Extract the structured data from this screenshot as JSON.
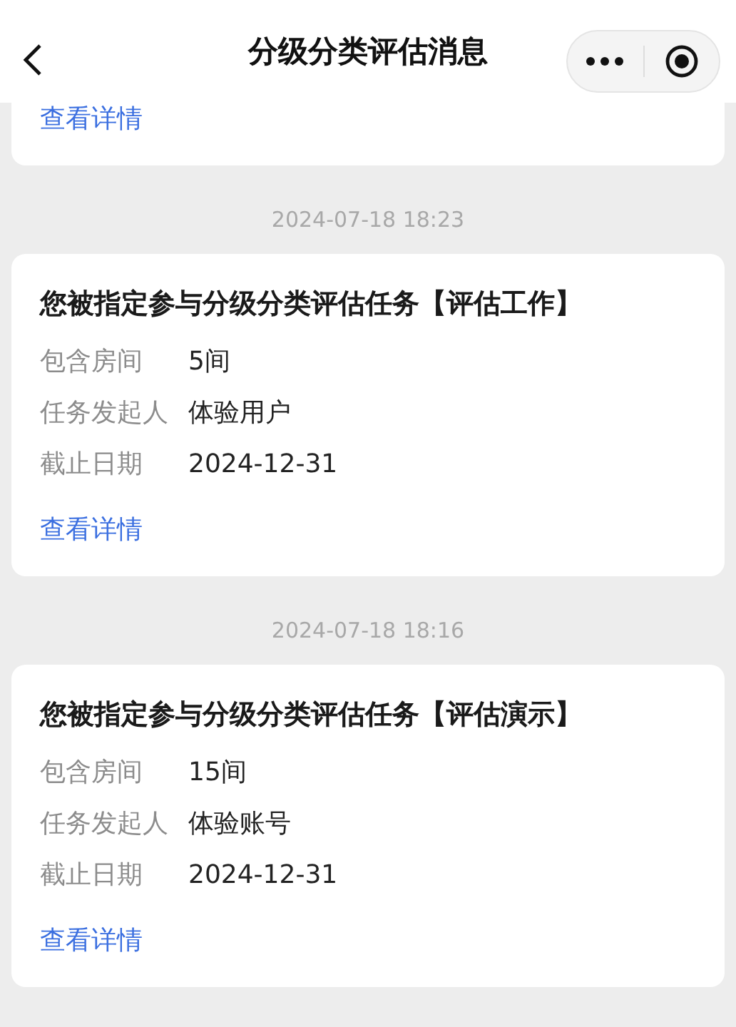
{
  "header": {
    "title": "分级分类评估消息"
  },
  "messages": [
    {
      "kind": "partial",
      "link": "查看详情"
    },
    {
      "kind": "full",
      "time": "2024-07-18 18:23",
      "title": "您被指定参与分级分类评估任务【评估工作】",
      "rows": [
        {
          "label": "包含房间",
          "value": "5间"
        },
        {
          "label": "任务发起人",
          "value": "体验用户"
        },
        {
          "label": "截止日期",
          "value": "2024-12-31"
        }
      ],
      "link": "查看详情"
    },
    {
      "kind": "full",
      "time": "2024-07-18 18:16",
      "title": "您被指定参与分级分类评估任务【评估演示】",
      "rows": [
        {
          "label": "包含房间",
          "value": "15间"
        },
        {
          "label": "任务发起人",
          "value": "体验账号"
        },
        {
          "label": "截止日期",
          "value": "2024-12-31"
        }
      ],
      "link": "查看详情"
    }
  ]
}
